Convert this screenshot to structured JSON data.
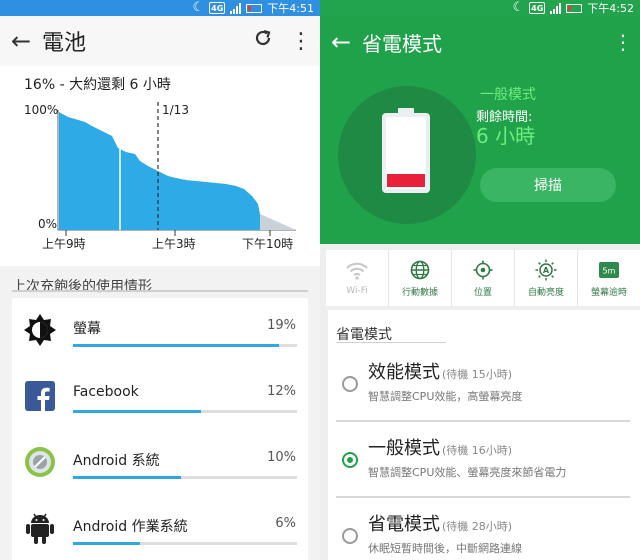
{
  "left": {
    "status": {
      "time": "下午4:51",
      "network": "4G"
    },
    "title": "電池",
    "summary": "16% - 大約還剩 6 小時",
    "chart_data": {
      "type": "area",
      "ylabels": [
        "100%",
        "0%"
      ],
      "xlabels": [
        "上午9時",
        "上午3時",
        "下午10時"
      ],
      "marker": "1/13",
      "colors": {
        "fill": "#2eaae6",
        "predicted": "#c9d2d8"
      }
    },
    "section_title": "上次充飽後的使用情形",
    "usage": [
      {
        "name": "螢幕",
        "percent": "19%",
        "bar": 0.92,
        "icon": "brightness-icon"
      },
      {
        "name": "Facebook",
        "percent": "12%",
        "bar": 0.57,
        "icon": "facebook-icon"
      },
      {
        "name": "Android 系統",
        "percent": "10%",
        "bar": 0.48,
        "icon": "android-system-icon"
      },
      {
        "name": "Android 作業系統",
        "percent": "6%",
        "bar": 0.3,
        "icon": "android-icon"
      }
    ]
  },
  "right": {
    "status": {
      "time": "下午4:52",
      "network": "4G"
    },
    "title": "省電模式",
    "current_mode": "一般模式",
    "remaining_label": "剩餘時間:",
    "remaining_value": "6 小時",
    "scan_button": "掃描",
    "toggles": [
      {
        "label": "Wi-Fi",
        "active": false,
        "icon": "wifi-icon"
      },
      {
        "label": "行動數據",
        "active": true,
        "icon": "globe-icon"
      },
      {
        "label": "位置",
        "active": true,
        "icon": "location-icon"
      },
      {
        "label": "自動亮度",
        "active": true,
        "icon": "auto-brightness-icon"
      },
      {
        "label": "螢幕逾時",
        "active": true,
        "icon": "screen-timeout-icon",
        "badge": "5m"
      }
    ],
    "modes_title": "省電模式",
    "modes": [
      {
        "name": "效能模式",
        "standby": "(待機 15小時)",
        "desc": "智慧調整CPU效能，高螢幕亮度",
        "selected": false
      },
      {
        "name": "一般模式",
        "standby": "(待機 16小時)",
        "desc": "智慧調整CPU效能、螢幕亮度來節省電力",
        "selected": true
      },
      {
        "name": "省電模式",
        "standby": "(待機 28小時)",
        "desc": "休眠短暫時間後，中斷網路連線",
        "selected": false
      }
    ],
    "colors": {
      "primary": "#20a24b",
      "accent": "#6fec7c"
    }
  }
}
